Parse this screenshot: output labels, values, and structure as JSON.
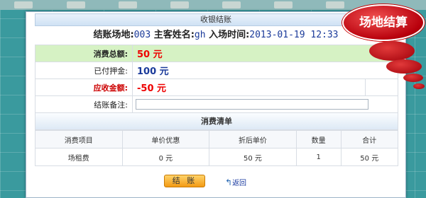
{
  "badge": "场地结算",
  "dialog_title": "收银结账",
  "info": {
    "field_label": "结账场地:",
    "field_value": "003",
    "customer_label": "主客姓名:",
    "customer_value": "gh",
    "time_label": "入场时间:",
    "time_value": "2013-01-19 12:33"
  },
  "form": {
    "total_label": "消费总额:",
    "total_value": "50 元",
    "deposit_label": "已付押金:",
    "deposit_value": "100 元",
    "due_label": "应收金额:",
    "due_value": "-50 元",
    "note_label": "结账备注:",
    "note_value": ""
  },
  "consumption": {
    "title": "消费清单",
    "headers": [
      "消费项目",
      "单价优惠",
      "折后单价",
      "数量",
      "合计"
    ],
    "rows": [
      [
        "场租费",
        "0 元",
        "50 元",
        "1",
        "50 元"
      ]
    ]
  },
  "actions": {
    "checkout_label": "结 账",
    "back_label": "返回"
  },
  "colors": {
    "accent_red": "#e00000",
    "value_blue": "#1a3a9a",
    "highlight_green": "#d6f2c4",
    "button_orange": "#f39a14"
  }
}
